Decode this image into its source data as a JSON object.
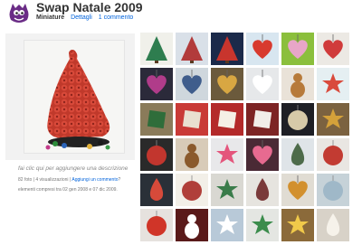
{
  "header": {
    "title": "Swap Natale 2009",
    "nav": {
      "current": "Miniature",
      "details": "Dettagli",
      "comments": "1 commento"
    }
  },
  "sidebar": {
    "caption": "fai clic qui per aggiungere una descrizione",
    "meta": {
      "count": "82 foto",
      "views": "4 visualizzazioni",
      "add_comment": "Aggiungi un commento",
      "separator": "|",
      "trailing": "?"
    },
    "date_range": "elementi compresi tra 02 gen 2008 e 07 dic 2009."
  },
  "thumbnails": [
    {
      "name": "thumb-green-tree",
      "bg": "#f0f0ea",
      "fg": "#2e7d4f",
      "shape": "tree"
    },
    {
      "name": "thumb-patchwork-tree",
      "bg": "#d9e0e8",
      "fg": "#b23b3b",
      "shape": "tree"
    },
    {
      "name": "thumb-red-tree",
      "bg": "#1b2a4a",
      "fg": "#c8352d",
      "shape": "tree"
    },
    {
      "name": "thumb-heart-ornament",
      "bg": "#d8e6f0",
      "fg": "#d83a2e",
      "shape": "heart"
    },
    {
      "name": "thumb-heart-fabric",
      "bg": "#8bbf3c",
      "fg": "#e8a6c8",
      "shape": "heart"
    },
    {
      "name": "thumb-cross-stitch-heart",
      "bg": "#ece9e4",
      "fg": "#d03b3b",
      "shape": "heart"
    },
    {
      "name": "thumb-purple-heart",
      "bg": "#2b2a3a",
      "fg": "#b03c8a",
      "shape": "heart"
    },
    {
      "name": "thumb-blue-heart",
      "bg": "#cfd7dd",
      "fg": "#3f5d8c",
      "shape": "heart"
    },
    {
      "name": "thumb-gold-heart",
      "bg": "#6b5a3c",
      "fg": "#d8a742",
      "shape": "heart"
    },
    {
      "name": "thumb-white-heart",
      "bg": "#e6e8ea",
      "fg": "#ffffff",
      "shape": "heart"
    },
    {
      "name": "thumb-gingerbread",
      "bg": "#e9e2d8",
      "fg": "#b77a3a",
      "shape": "person"
    },
    {
      "name": "thumb-star-stitch",
      "bg": "#e5eff2",
      "fg": "#d94a3c",
      "shape": "star"
    },
    {
      "name": "thumb-green-panel",
      "bg": "#8a7b5a",
      "fg": "#2f6d3a",
      "shape": "square"
    },
    {
      "name": "thumb-red-card",
      "bg": "#c93a36",
      "fg": "#e9e0d0",
      "shape": "square"
    },
    {
      "name": "thumb-red-stitched",
      "bg": "#b42a2a",
      "fg": "#f5f0e6",
      "shape": "square"
    },
    {
      "name": "thumb-tag-card",
      "bg": "#7d2424",
      "fg": "#f1ede8",
      "shape": "square"
    },
    {
      "name": "thumb-dark-bauble",
      "bg": "#1e1f25",
      "fg": "#d6c9a8",
      "shape": "circle"
    },
    {
      "name": "thumb-gold-star",
      "bg": "#7b6240",
      "fg": "#d4a13a",
      "shape": "star"
    },
    {
      "name": "thumb-dark-circle",
      "bg": "#2a2a2a",
      "fg": "#c2362e",
      "shape": "circle"
    },
    {
      "name": "thumb-teddy",
      "bg": "#d8cbb8",
      "fg": "#8b5a2c",
      "shape": "person"
    },
    {
      "name": "thumb-pink-star",
      "bg": "#e8e8ea",
      "fg": "#e4557c",
      "shape": "star"
    },
    {
      "name": "thumb-pink-heart",
      "bg": "#4a2a35",
      "fg": "#e76a90",
      "shape": "heart"
    },
    {
      "name": "thumb-string-ornament",
      "bg": "#dfe4e8",
      "fg": "#4d6b4a",
      "shape": "drop"
    },
    {
      "name": "thumb-stitched-red",
      "bg": "#e9e6e2",
      "fg": "#c23b32",
      "shape": "circle"
    },
    {
      "name": "thumb-bell",
      "bg": "#2a3038",
      "fg": "#d64a3a",
      "shape": "drop"
    },
    {
      "name": "thumb-button-ornament",
      "bg": "#f2efe8",
      "fg": "#b03f3a",
      "shape": "circle"
    },
    {
      "name": "thumb-ribbon-stars",
      "bg": "#d9d8d2",
      "fg": "#3a7c4a",
      "shape": "star"
    },
    {
      "name": "thumb-beaded-tree",
      "bg": "#e6e4df",
      "fg": "#7a3a3a",
      "shape": "drop"
    },
    {
      "name": "thumb-gold-heart-2",
      "bg": "#e0dcd3",
      "fg": "#d2902e",
      "shape": "heart"
    },
    {
      "name": "thumb-glass-bauble",
      "bg": "#c6d2d8",
      "fg": "#9fb8c8",
      "shape": "circle"
    },
    {
      "name": "thumb-red-bauble",
      "bg": "#e6e2de",
      "fg": "#d03528",
      "shape": "circle"
    },
    {
      "name": "thumb-snowman",
      "bg": "#5a1a1a",
      "fg": "#ffffff",
      "shape": "person"
    },
    {
      "name": "thumb-snowflake",
      "bg": "#b8c9d8",
      "fg": "#ffffff",
      "shape": "star"
    },
    {
      "name": "thumb-green-star",
      "bg": "#e4e6e2",
      "fg": "#3b8c4c",
      "shape": "star"
    },
    {
      "name": "thumb-yellow-star",
      "bg": "#8b6a3a",
      "fg": "#f0c94a",
      "shape": "star"
    },
    {
      "name": "thumb-angel",
      "bg": "#d8d2c8",
      "fg": "#f6f2ea",
      "shape": "drop"
    }
  ]
}
